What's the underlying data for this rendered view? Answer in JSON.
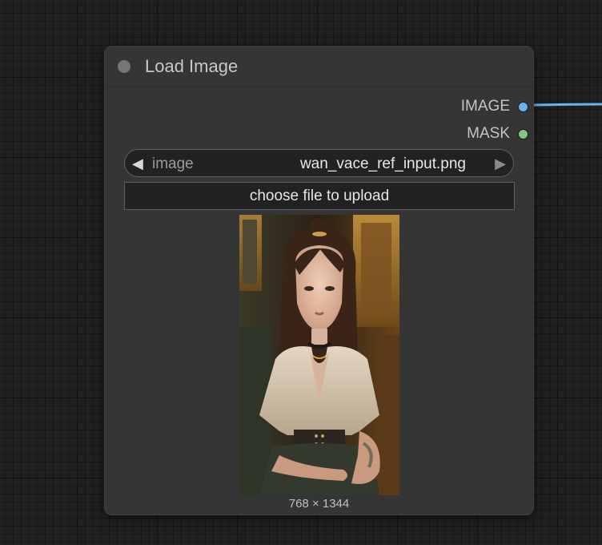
{
  "node": {
    "title": "Load Image",
    "outputs": [
      {
        "label": "IMAGE",
        "color": "#64b5f6"
      },
      {
        "label": "MASK",
        "color": "#81c784"
      }
    ],
    "image_widget": {
      "label": "image",
      "value": "wan_vace_ref_input.png",
      "left_arrow_icon": "triangle-left-icon",
      "right_arrow_icon": "triangle-right-icon"
    },
    "upload_button_label": "choose file to upload",
    "image_size_text": "768 × 1344"
  },
  "canvas": {
    "link_color": "#64b5f6",
    "background_color": "#202020"
  }
}
